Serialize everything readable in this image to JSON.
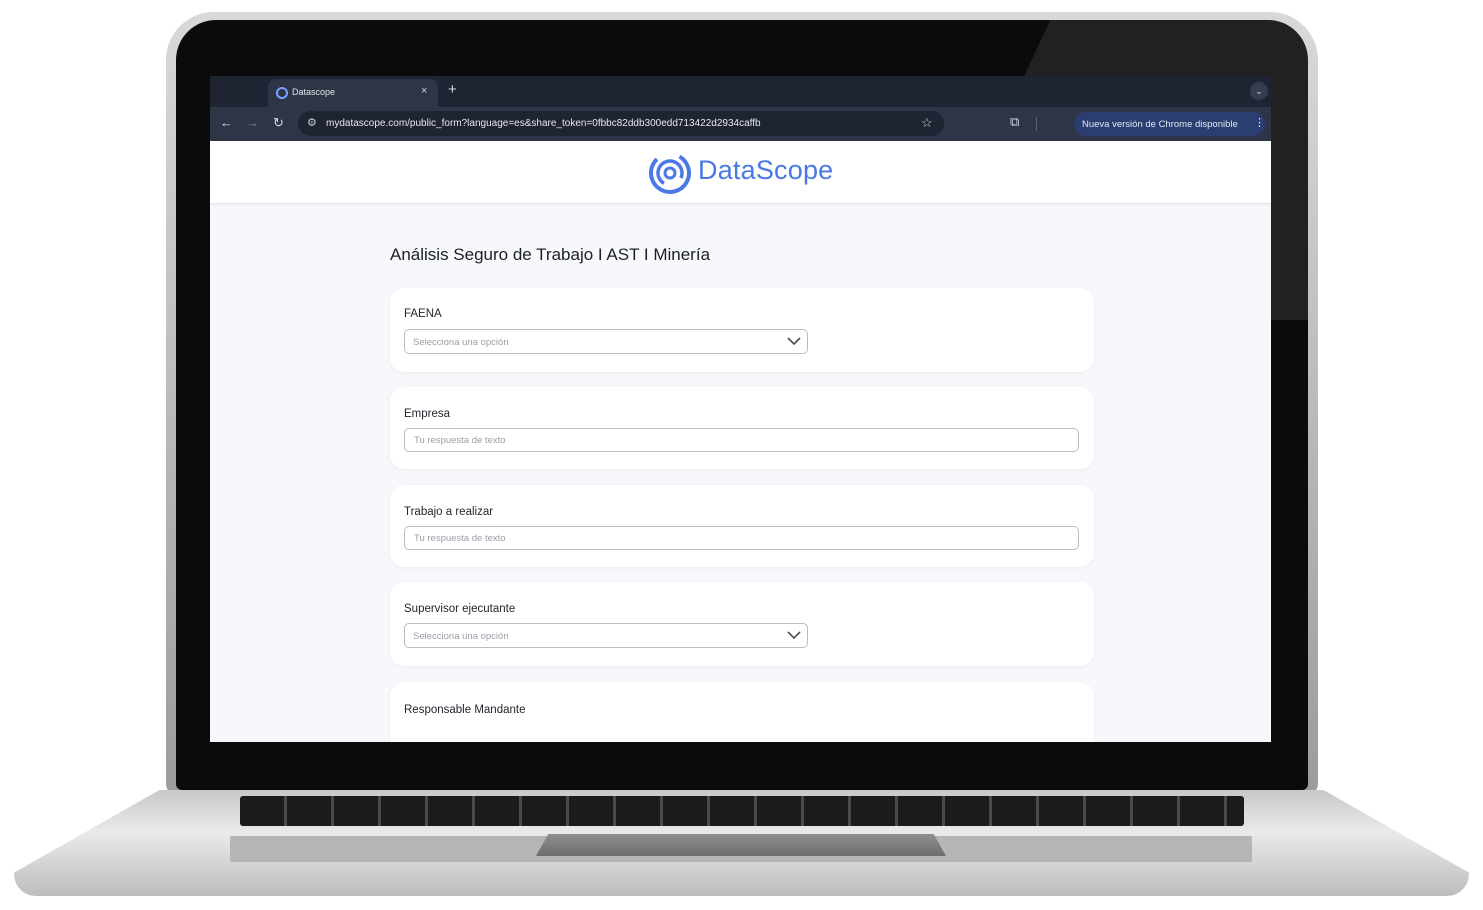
{
  "browser": {
    "tab_title": "Datascope",
    "new_tab_symbol": "+",
    "close_symbol": "×",
    "url": "mydatascope.com/public_form?language=es&share_token=0fbbc82ddb300edd713422d2934caffb",
    "update_label": "Nueva versión de Chrome disponible"
  },
  "header": {
    "logo_text": "DataScope",
    "brand_color": "#4a78e6"
  },
  "form": {
    "title": "Análisis Seguro de Trabajo I AST I Minería",
    "questions": [
      {
        "label": "FAENA",
        "type": "select",
        "placeholder": "Selecciona una opción"
      },
      {
        "label": "Empresa",
        "type": "text",
        "placeholder": "Tu respuesta de texto"
      },
      {
        "label": "Trabajo a realizar",
        "type": "text",
        "placeholder": "Tu respuesta de texto"
      },
      {
        "label": "Supervisor ejecutante",
        "type": "select",
        "placeholder": "Selecciona una opción"
      },
      {
        "label": "Responsable Mandante"
      }
    ]
  },
  "icons": [
    "back-arrow-icon",
    "forward-arrow-icon",
    "reload-icon",
    "site-info-icon",
    "bookmark-star-icon",
    "extensions-icon",
    "more-menu-icon",
    "chevron-down-icon"
  ]
}
